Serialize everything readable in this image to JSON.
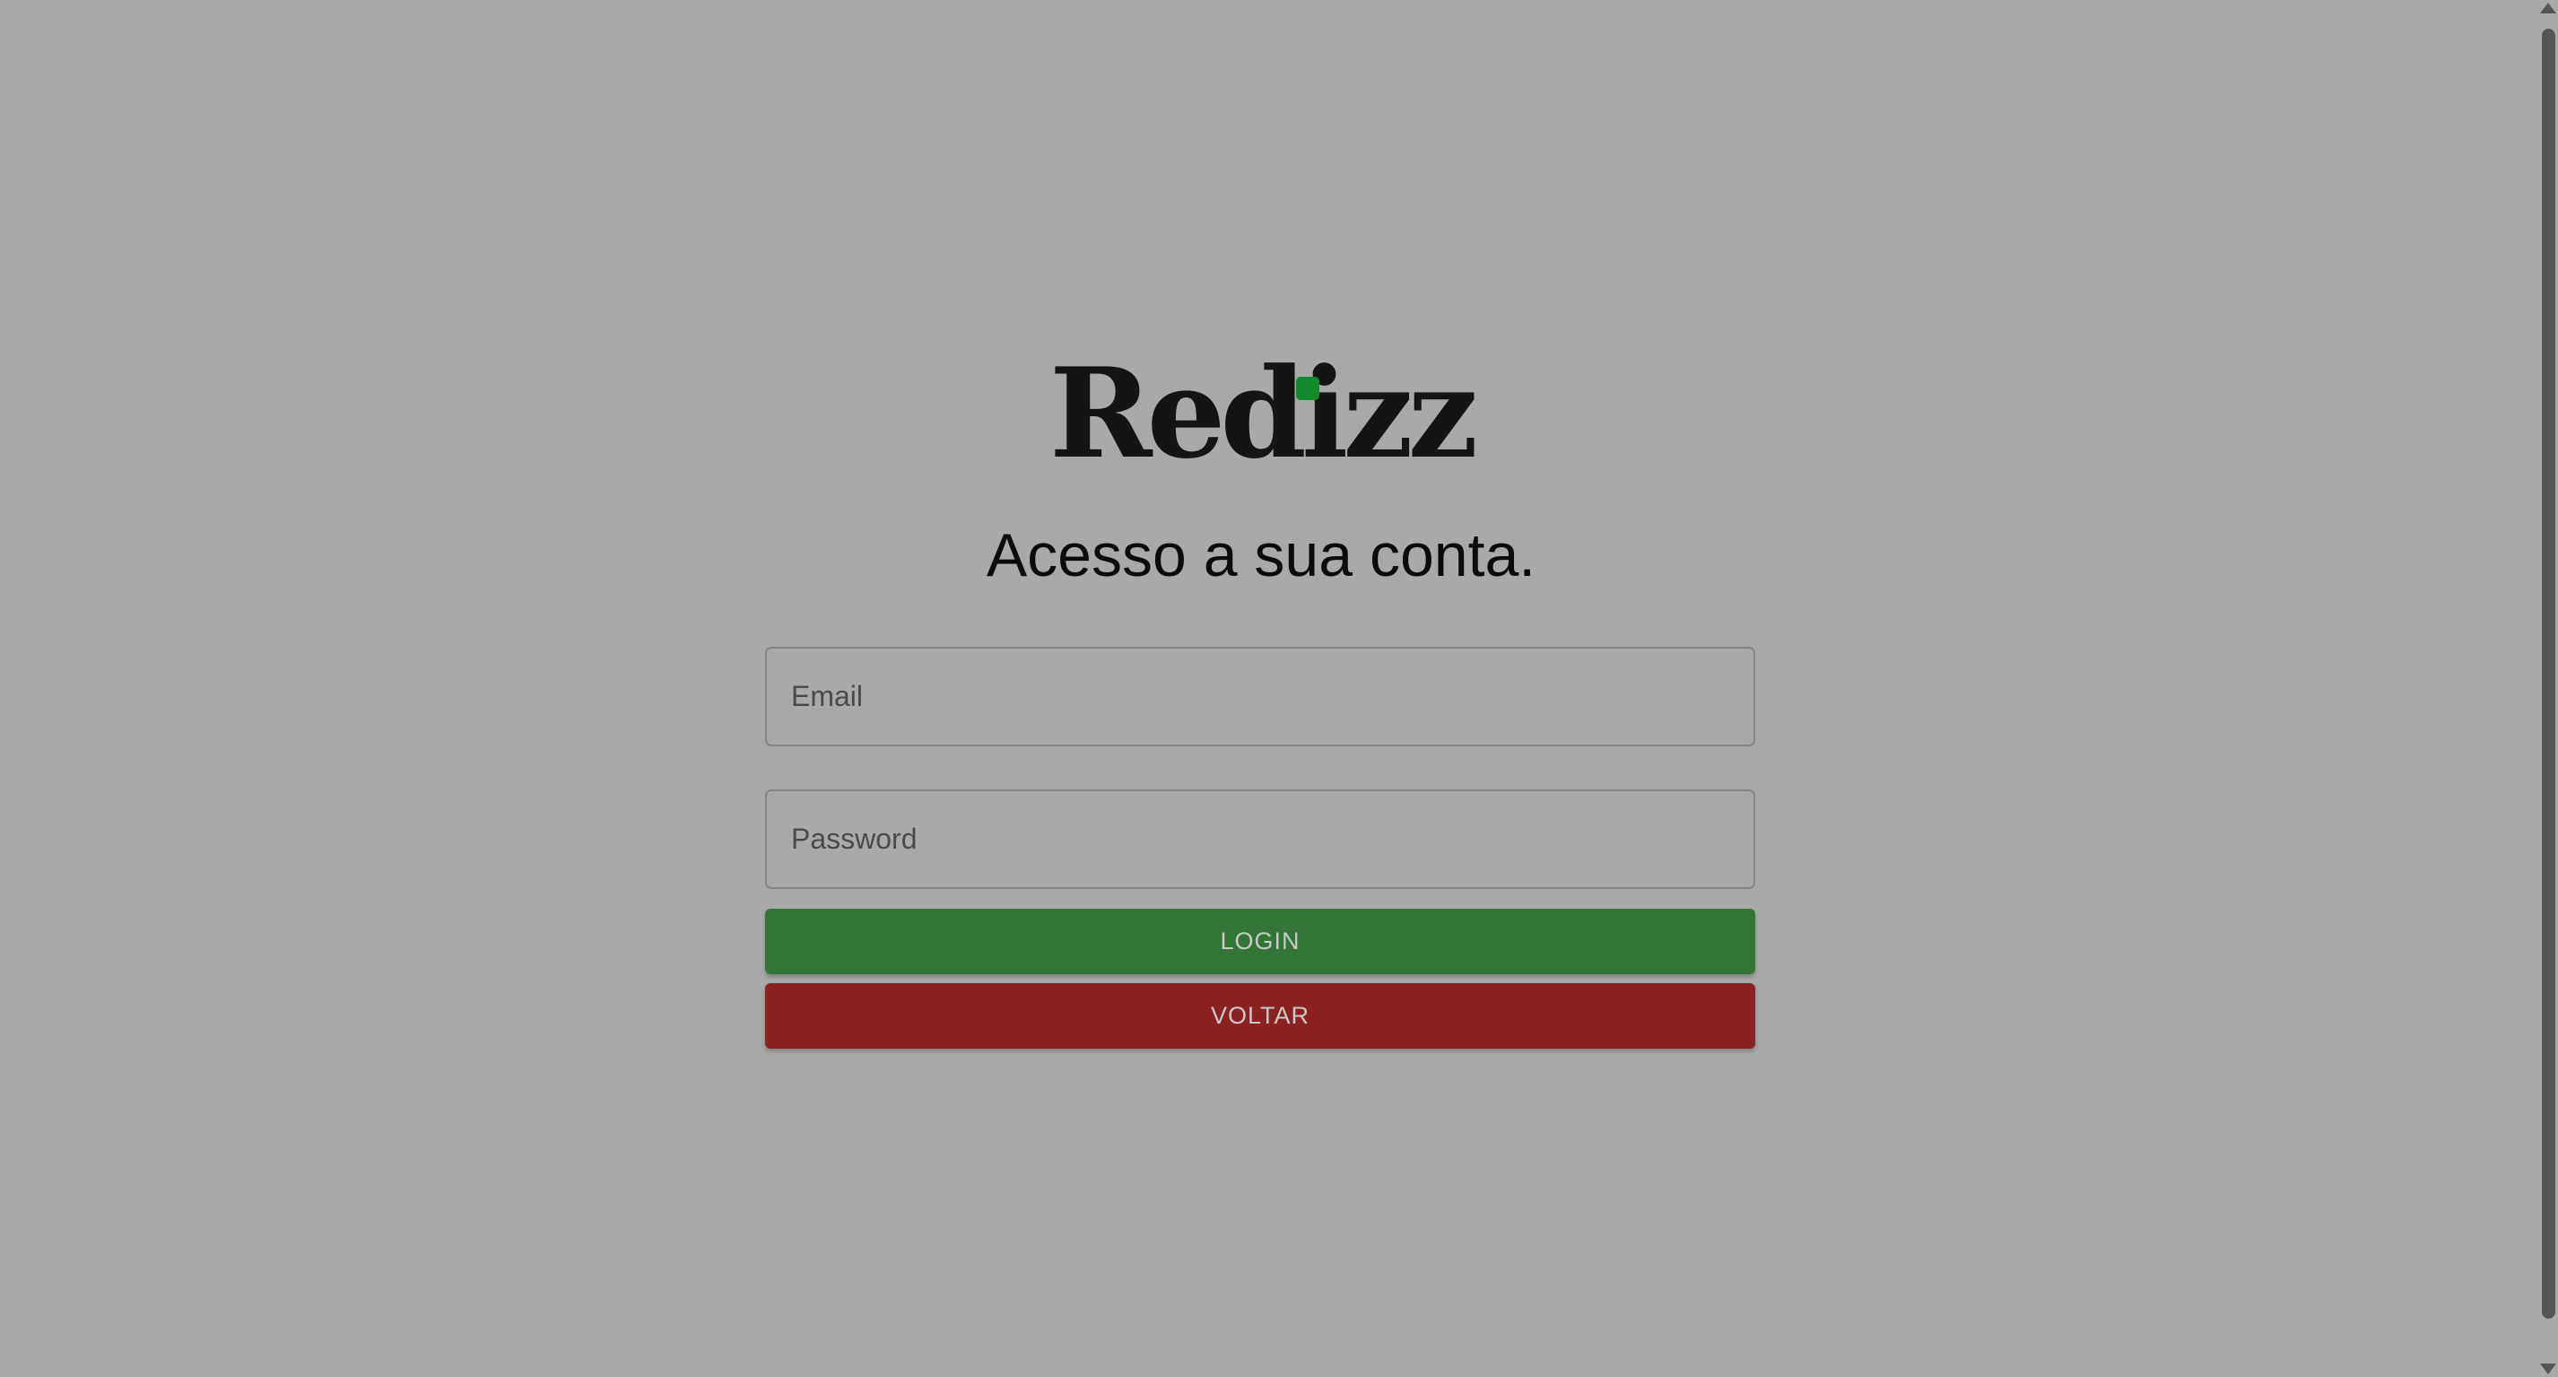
{
  "brand": {
    "logo_text": "Redizz",
    "dot_color": "#118a2d"
  },
  "login": {
    "title": "Acesso a sua conta.",
    "email_placeholder": "Email",
    "password_placeholder": "Password",
    "login_label": "LOGIN",
    "back_label": "VOLTAR"
  },
  "colors": {
    "background": "#a9a9a9",
    "login_button": "#337536",
    "back_button": "#8c2121"
  }
}
